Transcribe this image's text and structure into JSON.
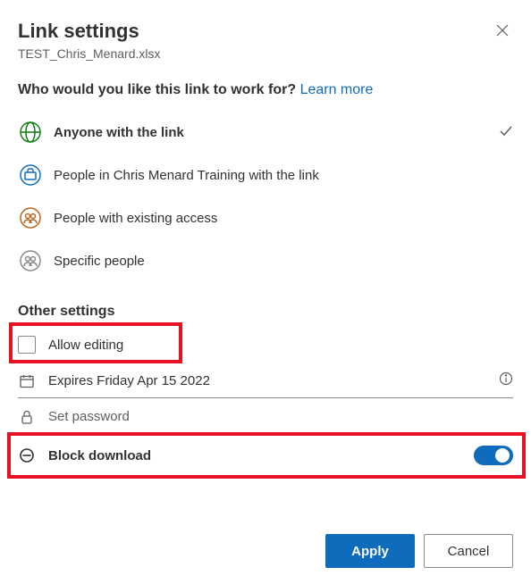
{
  "header": {
    "title": "Link settings",
    "filename": "TEST_Chris_Menard.xlsx"
  },
  "question": {
    "text": "Who would you like this link to work for? ",
    "learn_more": "Learn more"
  },
  "options": [
    {
      "id": "anyone",
      "label": "Anyone with the link",
      "selected": true
    },
    {
      "id": "org",
      "label": "People in Chris Menard Training with the link",
      "selected": false
    },
    {
      "id": "existing",
      "label": "People with existing access",
      "selected": false
    },
    {
      "id": "specific",
      "label": "Specific people",
      "selected": false
    }
  ],
  "other_settings": {
    "heading": "Other settings",
    "allow_editing": {
      "label": "Allow editing",
      "checked": false
    },
    "expiration": {
      "label": "Expires Friday Apr 15 2022"
    },
    "password": {
      "placeholder": "Set password",
      "value": ""
    },
    "block_download": {
      "label": "Block download",
      "enabled": true
    }
  },
  "footer": {
    "apply": "Apply",
    "cancel": "Cancel"
  }
}
